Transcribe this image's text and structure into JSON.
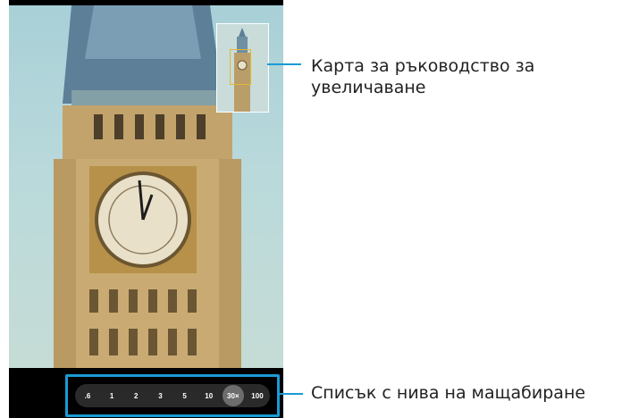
{
  "zoom_levels": [
    ".6",
    "1",
    "2",
    "3",
    "5",
    "10",
    "30×",
    "100"
  ],
  "active_zoom": "30×",
  "callouts": {
    "zoom_map": "Карта за ръководство за увеличаване",
    "zoom_list": "Списък с нива на мащабиране"
  },
  "colors": {
    "callout": "#1a9bd4",
    "zoom_frame": "#e3b733"
  }
}
